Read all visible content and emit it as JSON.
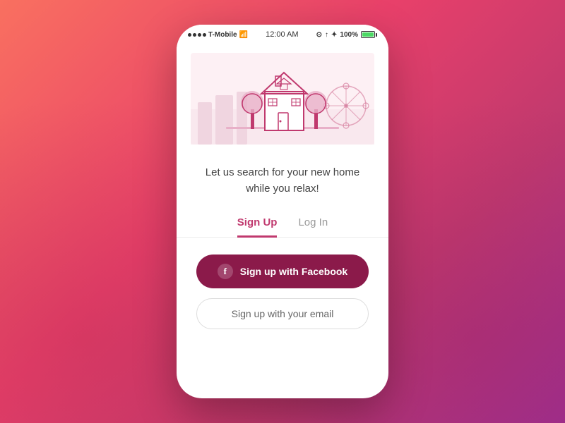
{
  "statusBar": {
    "carrier": "T-Mobile",
    "time": "12:00 AM",
    "battery": "100%"
  },
  "illustration": {
    "alt": "House with trees illustration"
  },
  "tagline": "Let us search for your new home while you relax!",
  "tabs": [
    {
      "label": "Sign Up",
      "active": true
    },
    {
      "label": "Log In",
      "active": false
    }
  ],
  "buttons": {
    "facebook": "Sign up with Facebook",
    "email": "Sign up with your email"
  },
  "colors": {
    "primary": "#c0396e",
    "dark_primary": "#8B1A4A",
    "background_gradient_start": "#f97060",
    "background_gradient_end": "#a03090"
  }
}
